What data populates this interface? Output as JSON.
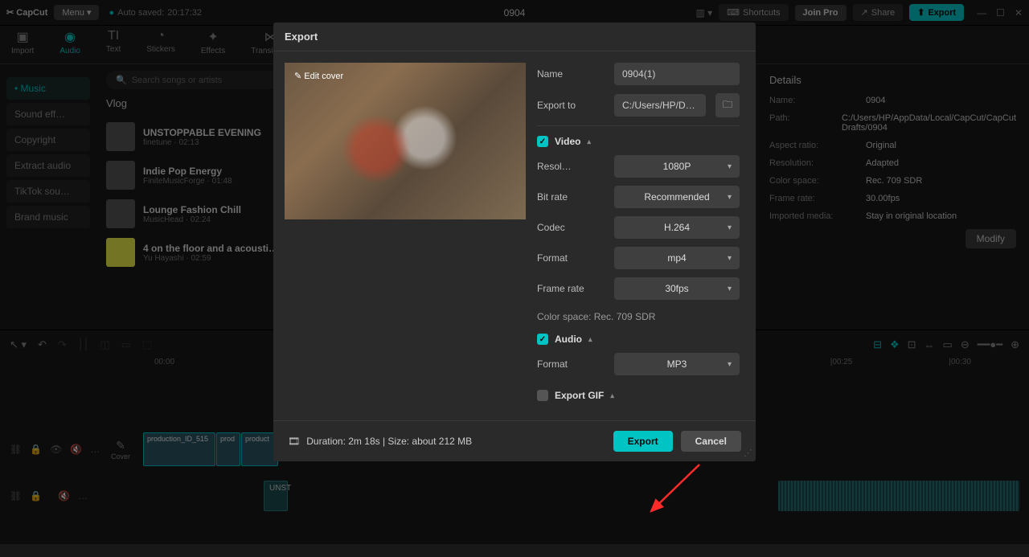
{
  "titlebar": {
    "logo": "✂ CapCut",
    "menu": "Menu ▾",
    "auto_saved_prefix": "Auto saved:",
    "auto_saved_time": "20:17:32",
    "project_title": "0904",
    "shortcuts": "Shortcuts",
    "join_pro": "Join Pro",
    "share": "Share",
    "export_top": "Export"
  },
  "tools": {
    "import": "Import",
    "audio": "Audio",
    "text": "Text",
    "stickers": "Stickers",
    "effects": "Effects",
    "transitions": "Transitions"
  },
  "sidebar": {
    "items": [
      {
        "label": "Music",
        "active": true
      },
      {
        "label": "Sound eff…",
        "active": false
      },
      {
        "label": "Copyright",
        "active": false
      },
      {
        "label": "Extract audio",
        "active": false
      },
      {
        "label": "TikTok sou…",
        "active": false
      },
      {
        "label": "Brand music",
        "active": false
      }
    ]
  },
  "music": {
    "search_placeholder": "Search songs or artists",
    "section": "Vlog",
    "tracks": [
      {
        "title": "UNSTOPPABLE EVENING",
        "artist": "finetune",
        "dur": "02:13"
      },
      {
        "title": "Indie Pop Energy",
        "artist": "FiniteMusicForge",
        "dur": "01:48"
      },
      {
        "title": "Lounge Fashion Chill",
        "artist": "MusicHead",
        "dur": "02:24"
      },
      {
        "title": "4 on the floor and a acousti…",
        "artist": "Yu Hayashi",
        "dur": "02:59"
      }
    ]
  },
  "details": {
    "title": "Details",
    "rows": [
      {
        "key": "Name:",
        "val": "0904"
      },
      {
        "key": "Path:",
        "val": "C:/Users/HP/AppData/Local/CapCut/CapCut Drafts/0904"
      },
      {
        "key": "Aspect ratio:",
        "val": "Original"
      },
      {
        "key": "Resolution:",
        "val": "Adapted"
      },
      {
        "key": "Color space:",
        "val": "Rec. 709 SDR"
      },
      {
        "key": "Frame rate:",
        "val": "30.00fps"
      },
      {
        "key": "Imported media:",
        "val": "Stay in original location"
      }
    ],
    "modify": "Modify"
  },
  "timeline": {
    "t0": "00:00",
    "t25": "|00:25",
    "t30": "|00:30",
    "cover_label": "Cover",
    "clip1": "production_ID_515",
    "clip2": "prod",
    "clip3": "product",
    "audio_clip": "UNST"
  },
  "modal": {
    "title": "Export",
    "edit_cover": "✎ Edit cover",
    "name_label": "Name",
    "name_value": "0904(1)",
    "export_to_label": "Export to",
    "export_to_value": "C:/Users/HP/Downlo…",
    "video_section": "Video",
    "resolution_label": "Resol…",
    "resolution_value": "1080P",
    "bitrate_label": "Bit rate",
    "bitrate_value": "Recommended",
    "codec_label": "Codec",
    "codec_value": "H.264",
    "format_label": "Format",
    "format_value": "mp4",
    "framerate_label": "Frame rate",
    "framerate_value": "30fps",
    "colorspace": "Color space: Rec. 709 SDR",
    "audio_section": "Audio",
    "audio_format_label": "Format",
    "audio_format_value": "MP3",
    "gif_section": "Export GIF",
    "footer_info": "Duration: 2m 18s | Size: about 212 MB",
    "export_btn": "Export",
    "cancel_btn": "Cancel"
  }
}
